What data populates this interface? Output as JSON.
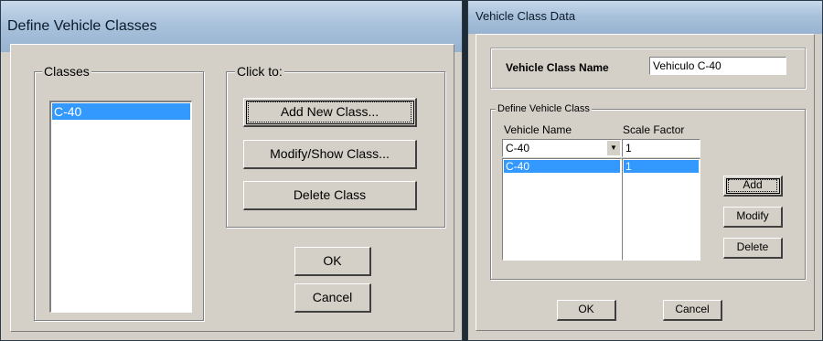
{
  "define_dialog": {
    "title": "Define Vehicle Classes",
    "classes_group": "Classes",
    "classes": [
      "C-40"
    ],
    "click_to_group": "Click to:",
    "add_new_class": "Add New Class...",
    "modify_show_class": "Modify/Show Class...",
    "delete_class": "Delete Class",
    "ok": "OK",
    "cancel": "Cancel"
  },
  "vehicle_class_data": {
    "title": "Vehicle Class Data",
    "class_name_label": "Vehicle Class Name",
    "class_name_value": "Vehiculo C-40",
    "define_group": "Define Vehicle Class",
    "vehicle_name_header": "Vehicle Name",
    "scale_factor_header": "Scale Factor",
    "vehicle_name_selected": "C-40",
    "scale_factor_value": "1",
    "rows": [
      {
        "vehicle": "C-40",
        "scale": "1"
      }
    ],
    "add": "Add",
    "modify": "Modify",
    "delete": "Delete",
    "ok": "OK",
    "cancel": "Cancel"
  }
}
